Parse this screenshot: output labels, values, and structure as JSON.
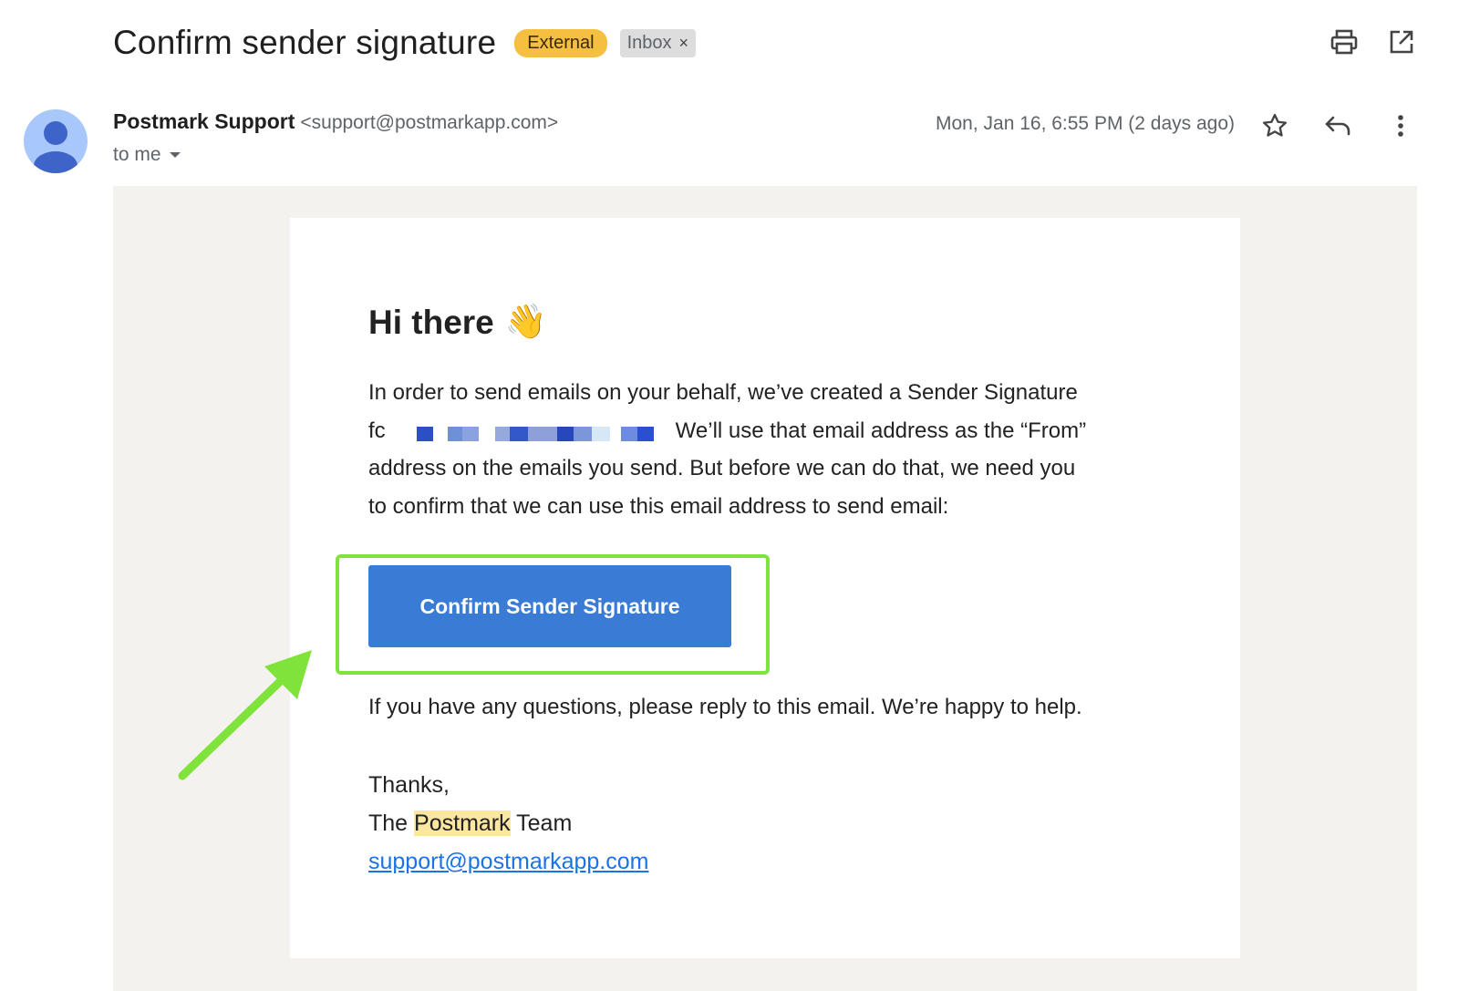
{
  "subject": "Confirm sender signature",
  "labels": {
    "external": "External",
    "inbox": "Inbox",
    "inbox_remove": "×"
  },
  "sender": {
    "name": "Postmark Support",
    "email": "<support@postmarkapp.com>",
    "to": "to me"
  },
  "date": "Mon, Jan 16, 6:55 PM (2 days ago)",
  "icons": {
    "print": "print-icon",
    "open_new": "open-in-new-window-icon",
    "star": "star-icon",
    "reply": "reply-icon",
    "more": "more-vertical-icon",
    "avatar": "avatar"
  },
  "body": {
    "greeting": "Hi there",
    "greeting_emoji": "👋",
    "para1_line1": "In order to send emails on your behalf, we’ve created a Sender Signature",
    "para1_prefix": "fc",
    "para1_line2_rest": "We’ll use that email address as the “From”",
    "para1_line3": "address on the emails you send. But before we can do that, we need you",
    "para1_line4": "to confirm that we can use this email address to send email:",
    "button_label": "Confirm Sender Signature",
    "para2": "If you have any questions, please reply to this email. We’re happy to help.",
    "thanks": "Thanks,",
    "team_prefix": "The",
    "team_brand": "Postmark",
    "team_suffix": "Team",
    "link": "support@postmarkapp.com"
  },
  "colors": {
    "external_label": "#f5bf42",
    "button": "#3a7bd5",
    "highlight": "#7fe33b",
    "mail_bg": "#f4f2ee"
  }
}
